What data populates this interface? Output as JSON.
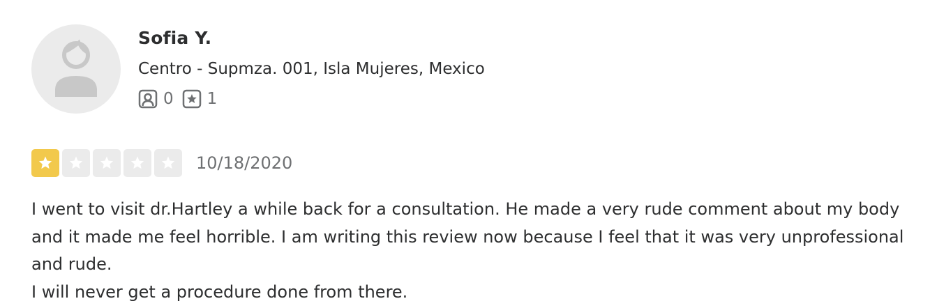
{
  "user": {
    "name": "Sofia Y.",
    "location": "Centro - Supmza. 001, Isla Mujeres, Mexico",
    "friends_count": "0",
    "reviews_count": "1"
  },
  "icons": {
    "avatar": "default-user-avatar-icon",
    "friends": "friends-icon",
    "reviews": "reviews-star-icon",
    "star": "star-icon"
  },
  "review": {
    "rating": 1,
    "max_rating": 5,
    "date": "10/18/2020",
    "paragraphs": [
      "I went to visit dr.Hartley a while back for a consultation. He made a very rude comment about my body and it made me feel horrible. I am writing this review now because I feel that it was very unprofessional and rude.",
      "I will never get a procedure done from there."
    ]
  },
  "colors": {
    "star_active": "#f2c94c",
    "star_inactive": "#ebebeb",
    "avatar_bg": "#ebebeb",
    "avatar_fg": "#c8c8c8",
    "text_primary": "#2d2e2f",
    "text_secondary": "#6e7072"
  }
}
